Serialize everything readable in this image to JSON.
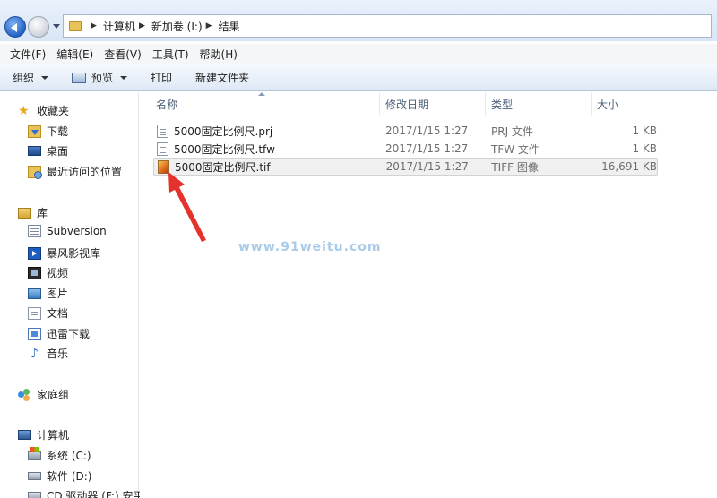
{
  "breadcrumbs": [
    "计算机",
    "新加卷 (I:)",
    "结果"
  ],
  "menu": [
    "文件(F)",
    "编辑(E)",
    "查看(V)",
    "工具(T)",
    "帮助(H)"
  ],
  "toolbar": {
    "organize": "组织",
    "preview": "预览",
    "print": "打印",
    "new_folder": "新建文件夹"
  },
  "sidebar": {
    "favorites": {
      "label": "收藏夹",
      "items": [
        "下载",
        "桌面",
        "最近访问的位置"
      ]
    },
    "libraries": {
      "label": "库",
      "items": [
        "Subversion",
        "暴风影视库",
        "视频",
        "图片",
        "文档",
        "迅雷下载",
        "音乐"
      ]
    },
    "homegroup": "家庭组",
    "computer": {
      "label": "计算机",
      "items": [
        "系统 (C:)",
        "软件 (D:)",
        "CD 驱动器 (F:) 安平"
      ]
    }
  },
  "columns": {
    "name": "名称",
    "date": "修改日期",
    "type": "类型",
    "size": "大小"
  },
  "files": [
    {
      "name": "5000固定比例尺.prj",
      "date": "2017/1/15 1:27",
      "type": "PRJ 文件",
      "size": "1 KB",
      "icon": "text-file-icon"
    },
    {
      "name": "5000固定比例尺.tfw",
      "date": "2017/1/15 1:27",
      "type": "TFW 文件",
      "size": "1 KB",
      "icon": "text-file-icon"
    },
    {
      "name": "5000固定比例尺.tif",
      "date": "2017/1/15 1:27",
      "type": "TIFF 图像",
      "size": "16,691 KB",
      "icon": "image-file-icon"
    }
  ],
  "watermark": "www.91weitu.com",
  "colors": {
    "arrow": "#e5322d",
    "accent": "#2563c4"
  }
}
